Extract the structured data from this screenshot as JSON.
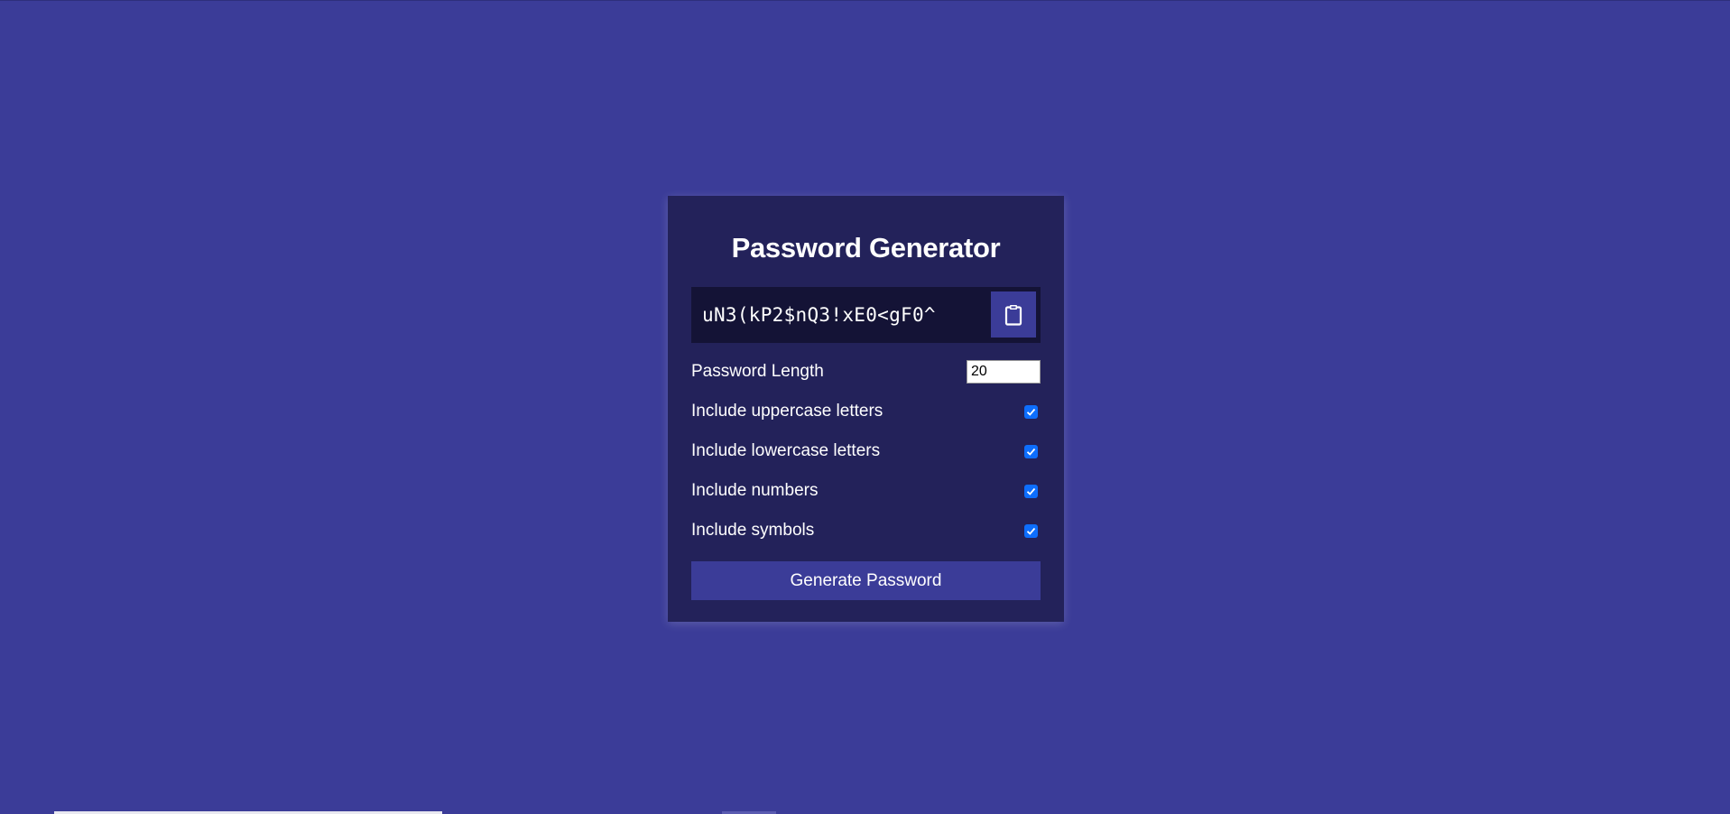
{
  "app": {
    "title": "Password Generator"
  },
  "result": {
    "password": "uN3(kP2$nQ3!xE0<gF0^",
    "clipboard_icon": "clipboard-icon"
  },
  "settings": {
    "length_label": "Password Length",
    "length_value": "20",
    "options": [
      {
        "label": "Include uppercase letters",
        "checked": true
      },
      {
        "label": "Include lowercase letters",
        "checked": true
      },
      {
        "label": "Include numbers",
        "checked": true
      },
      {
        "label": "Include symbols",
        "checked": true
      }
    ]
  },
  "generate_button": {
    "label": "Generate Password"
  },
  "colors": {
    "background": "#3b3c98",
    "card": "#23225a",
    "result_bg": "#141336",
    "accent": "#3b3c98",
    "checkbox": "#0d6efd"
  }
}
